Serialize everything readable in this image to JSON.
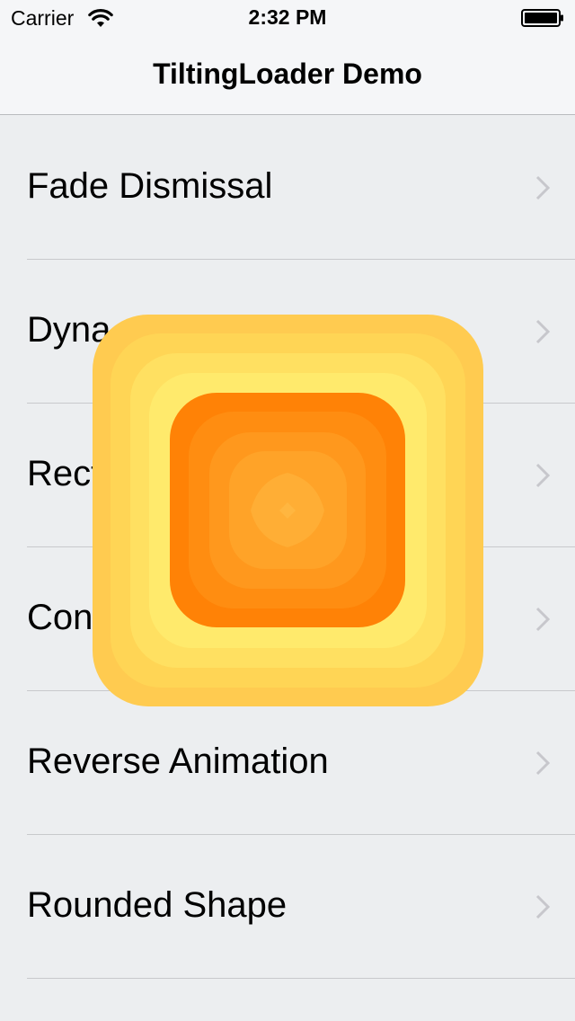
{
  "status_bar": {
    "carrier": "Carrier",
    "time": "2:32 PM",
    "icons": [
      "wifi-icon",
      "battery-icon"
    ]
  },
  "nav": {
    "title": "TiltingLoader Demo"
  },
  "list": {
    "items": [
      {
        "label": "Fade Dismissal"
      },
      {
        "label": "Dyna"
      },
      {
        "label": "Rect"
      },
      {
        "label": "Con"
      },
      {
        "label": "Reverse Animation"
      },
      {
        "label": "Rounded Shape"
      }
    ],
    "accessory_icon": "chevron-right-icon"
  },
  "loader": {
    "outer_colors": [
      "#ffcb50",
      "#ffd555",
      "#ffe061",
      "#ffea6c",
      "#fff579"
    ],
    "inner_colors": [
      "#ff8206",
      "#ff8d11",
      "#ff981d",
      "#ffa328",
      "#ffae35"
    ]
  },
  "colors": {
    "background": "#eceef0",
    "nav_background": "#f5f6f8",
    "separator": "#c8c9cc",
    "chevron": "#c7c7cc"
  }
}
